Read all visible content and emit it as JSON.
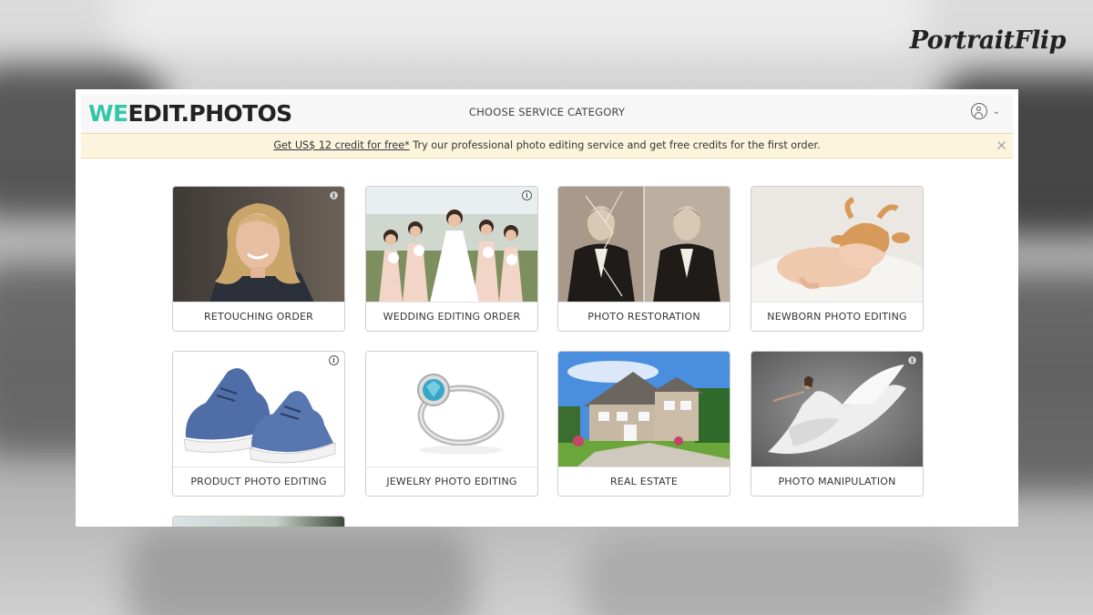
{
  "watermark": {
    "brand": "PortraitFlip"
  },
  "header": {
    "logo_we": "WE",
    "logo_rest": "EDIT.PHOTOS",
    "title": "CHOOSE SERVICE CATEGORY",
    "account_chevron": "⌄"
  },
  "promo": {
    "link_text": "Get US$ 12 credit for free*",
    "message": " Try our professional photo editing service and get free credits for the first order.",
    "close": "✕"
  },
  "categories": [
    {
      "label": "RETOUCHING ORDER",
      "info": true,
      "image": "portrait-woman"
    },
    {
      "label": "WEDDING EDITING ORDER",
      "info": true,
      "image": "wedding-bridesmaids"
    },
    {
      "label": "PHOTO RESTORATION",
      "info": false,
      "image": "old-photo-before-after"
    },
    {
      "label": "NEWBORN PHOTO EDITING",
      "info": false,
      "image": "sleeping-newborn"
    },
    {
      "label": "PRODUCT PHOTO EDITING",
      "info": true,
      "image": "blue-sneakers"
    },
    {
      "label": "JEWELRY PHOTO EDITING",
      "info": false,
      "image": "diamond-ring"
    },
    {
      "label": "REAL ESTATE",
      "info": false,
      "image": "house-exterior"
    },
    {
      "label": "PHOTO MANIPULATION",
      "info": true,
      "image": "dancer-white-dress"
    }
  ],
  "info_glyph": "i"
}
